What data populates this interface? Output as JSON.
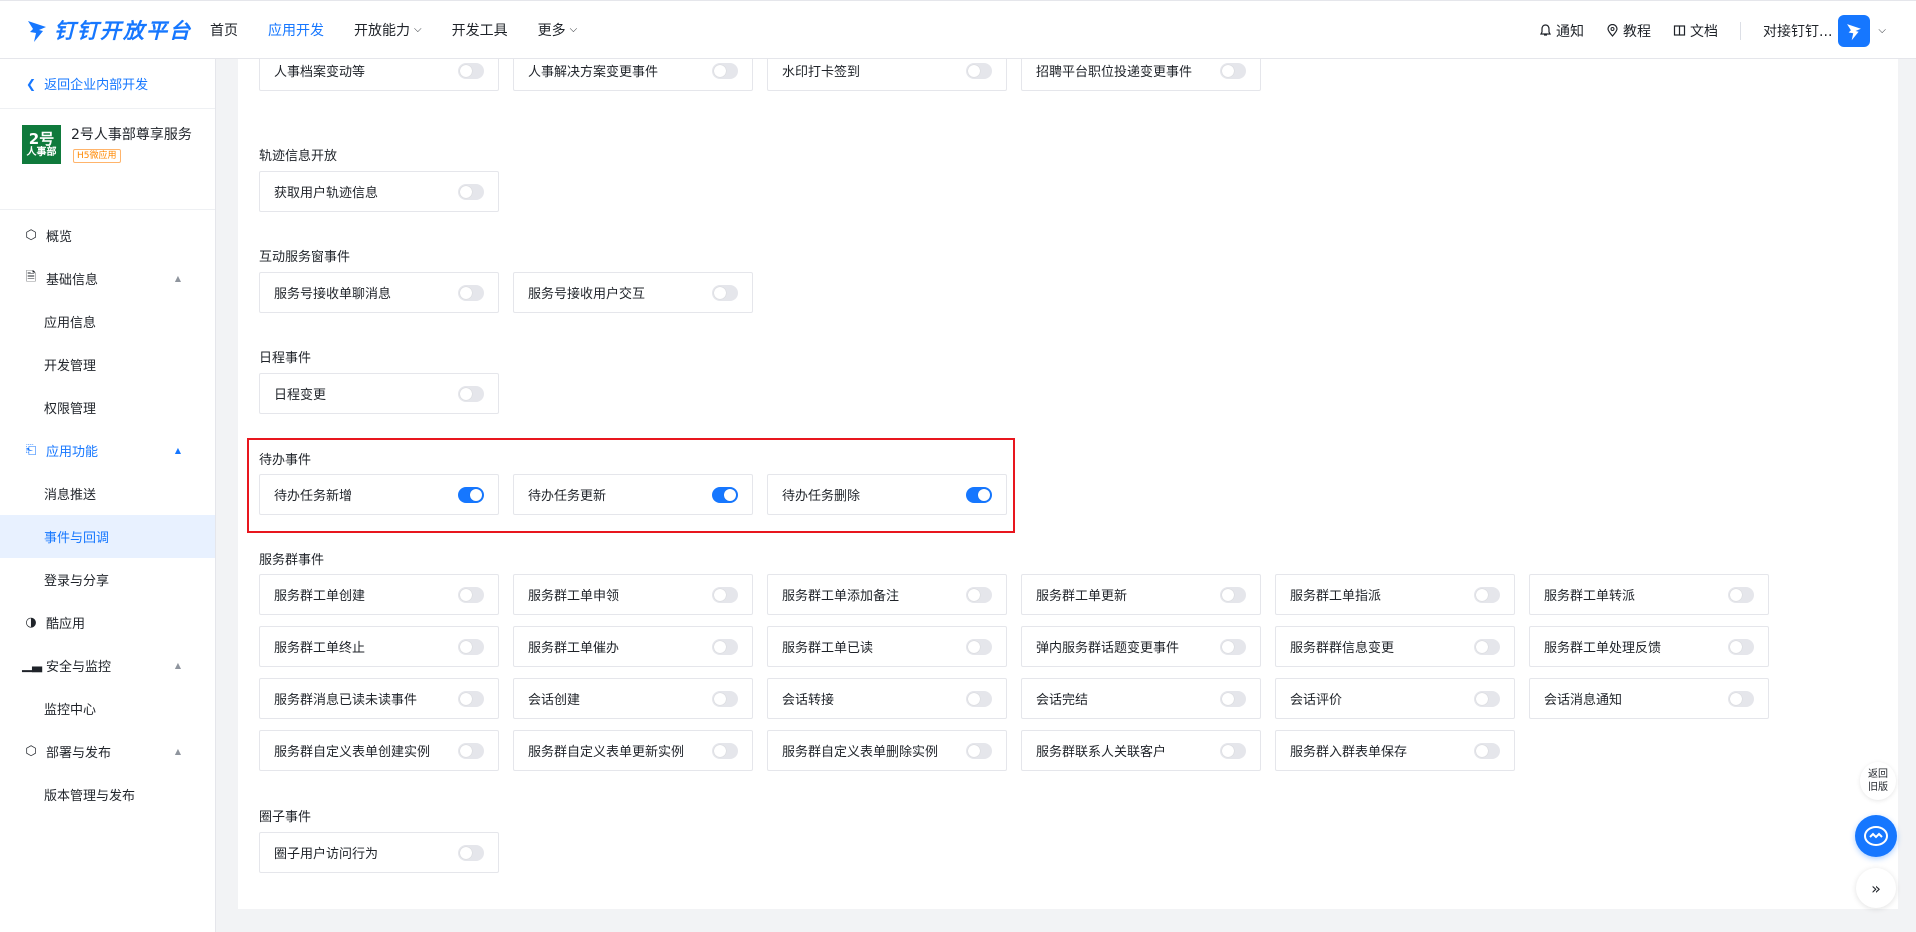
{
  "brand": {
    "name": "钉钉开放平台",
    "color": "#1677ff"
  },
  "nav": {
    "items": [
      {
        "label": "首页",
        "active": false,
        "dropdown": false
      },
      {
        "label": "应用开发",
        "active": true,
        "dropdown": false
      },
      {
        "label": "开放能力",
        "active": false,
        "dropdown": true
      },
      {
        "label": "开发工具",
        "active": false,
        "dropdown": false
      },
      {
        "label": "更多",
        "active": false,
        "dropdown": true
      }
    ]
  },
  "header_right": {
    "notify": "通知",
    "tutorial": "教程",
    "docs": "文档",
    "account": "对接钉钉..."
  },
  "sidebar": {
    "back": "返回企业内部开发",
    "app": {
      "name": "2号人事部尊享服务",
      "tag": "H5微应用",
      "avatar_top": "2号",
      "avatar_bottom": "人事部"
    },
    "menu": {
      "overview": "概览",
      "basic_info": "基础信息",
      "app_info": "应用信息",
      "dev_mgmt": "开发管理",
      "perm_mgmt": "权限管理",
      "app_features": "应用功能",
      "msg_push": "消息推送",
      "events": "事件与回调",
      "login_share": "登录与分享",
      "cool_app": "酷应用",
      "security": "安全与监控",
      "monitor": "监控中心",
      "deploy": "部署与发布",
      "version": "版本管理与发布"
    }
  },
  "sections": {
    "top_row": [
      {
        "label": "人事档案变动等",
        "on": false
      },
      {
        "label": "人事解决方案变更事件",
        "on": false
      },
      {
        "label": "水印打卡签到",
        "on": false
      },
      {
        "label": "招聘平台职位投递变更事件",
        "on": false
      }
    ],
    "track": {
      "title": "轨迹信息开放",
      "items": [
        {
          "label": "获取用户轨迹信息",
          "on": false
        }
      ]
    },
    "interactive": {
      "title": "互动服务窗事件",
      "items": [
        {
          "label": "服务号接收单聊消息",
          "on": false
        },
        {
          "label": "服务号接收用户交互",
          "on": false
        }
      ]
    },
    "schedule": {
      "title": "日程事件",
      "items": [
        {
          "label": "日程变更",
          "on": false
        }
      ]
    },
    "todo": {
      "title": "待办事件",
      "items": [
        {
          "label": "待办任务新增",
          "on": true
        },
        {
          "label": "待办任务更新",
          "on": true
        },
        {
          "label": "待办任务删除",
          "on": true
        }
      ]
    },
    "service_group": {
      "title": "服务群事件",
      "rows": [
        [
          {
            "label": "服务群工单创建",
            "on": false
          },
          {
            "label": "服务群工单申领",
            "on": false
          },
          {
            "label": "服务群工单添加备注",
            "on": false
          },
          {
            "label": "服务群工单更新",
            "on": false
          },
          {
            "label": "服务群工单指派",
            "on": false
          },
          {
            "label": "服务群工单转派",
            "on": false
          }
        ],
        [
          {
            "label": "服务群工单终止",
            "on": false
          },
          {
            "label": "服务群工单催办",
            "on": false
          },
          {
            "label": "服务群工单已读",
            "on": false
          },
          {
            "label": "弹内服务群话题变更事件",
            "on": false
          },
          {
            "label": "服务群群信息变更",
            "on": false
          },
          {
            "label": "服务群工单处理反馈",
            "on": false
          }
        ],
        [
          {
            "label": "服务群消息已读未读事件",
            "on": false
          },
          {
            "label": "会话创建",
            "on": false
          },
          {
            "label": "会话转接",
            "on": false
          },
          {
            "label": "会话完结",
            "on": false
          },
          {
            "label": "会话评价",
            "on": false
          },
          {
            "label": "会话消息通知",
            "on": false
          }
        ],
        [
          {
            "label": "服务群自定义表单创建实例",
            "on": false
          },
          {
            "label": "服务群自定义表单更新实例",
            "on": false
          },
          {
            "label": "服务群自定义表单删除实例",
            "on": false
          },
          {
            "label": "服务群联系人关联客户",
            "on": false
          },
          {
            "label": "服务群入群表单保存",
            "on": false
          }
        ]
      ]
    },
    "circle": {
      "title": "圈子事件",
      "items": [
        {
          "label": "圈子用户访问行为",
          "on": false
        }
      ]
    }
  },
  "floating": {
    "old_version_line1": "返回",
    "old_version_line2": "旧版"
  },
  "colors": {
    "accent": "#1677ff",
    "highlight": "#e8161e",
    "toggle_off": "#e5e6eb"
  }
}
